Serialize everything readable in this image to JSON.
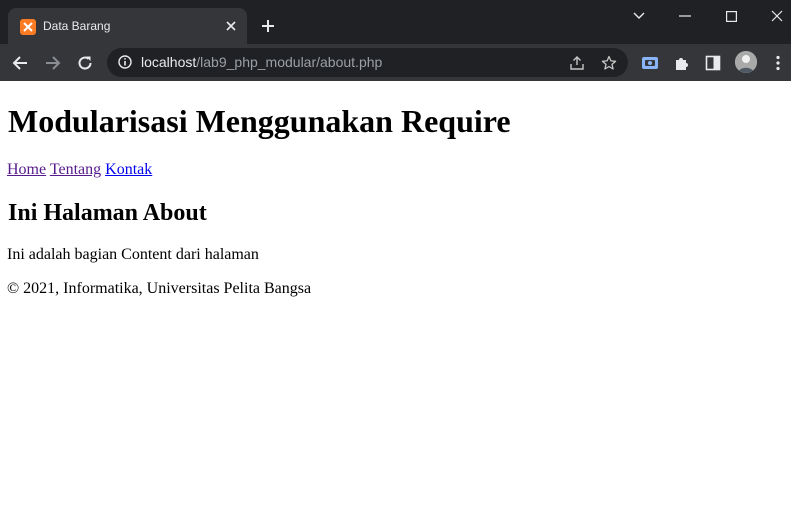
{
  "browser": {
    "tab": {
      "title": "Data Barang",
      "favicon": "xampp-icon"
    },
    "address": {
      "host": "localhost",
      "path": "/lab9_php_modular/about.php"
    },
    "colors": {
      "frame": "#202124",
      "toolbar": "#35363a",
      "favicon": "#fb7a24"
    }
  },
  "page": {
    "heading": "Modularisasi Menggunakan Require",
    "nav": [
      {
        "label": "Home"
      },
      {
        "label": "Tentang"
      },
      {
        "label": "Kontak"
      }
    ],
    "subheading": "Ini Halaman About",
    "paragraph": "Ini adalah bagian Content dari halaman",
    "footer": "© 2021, Informatika, Universitas Pelita Bangsa"
  }
}
